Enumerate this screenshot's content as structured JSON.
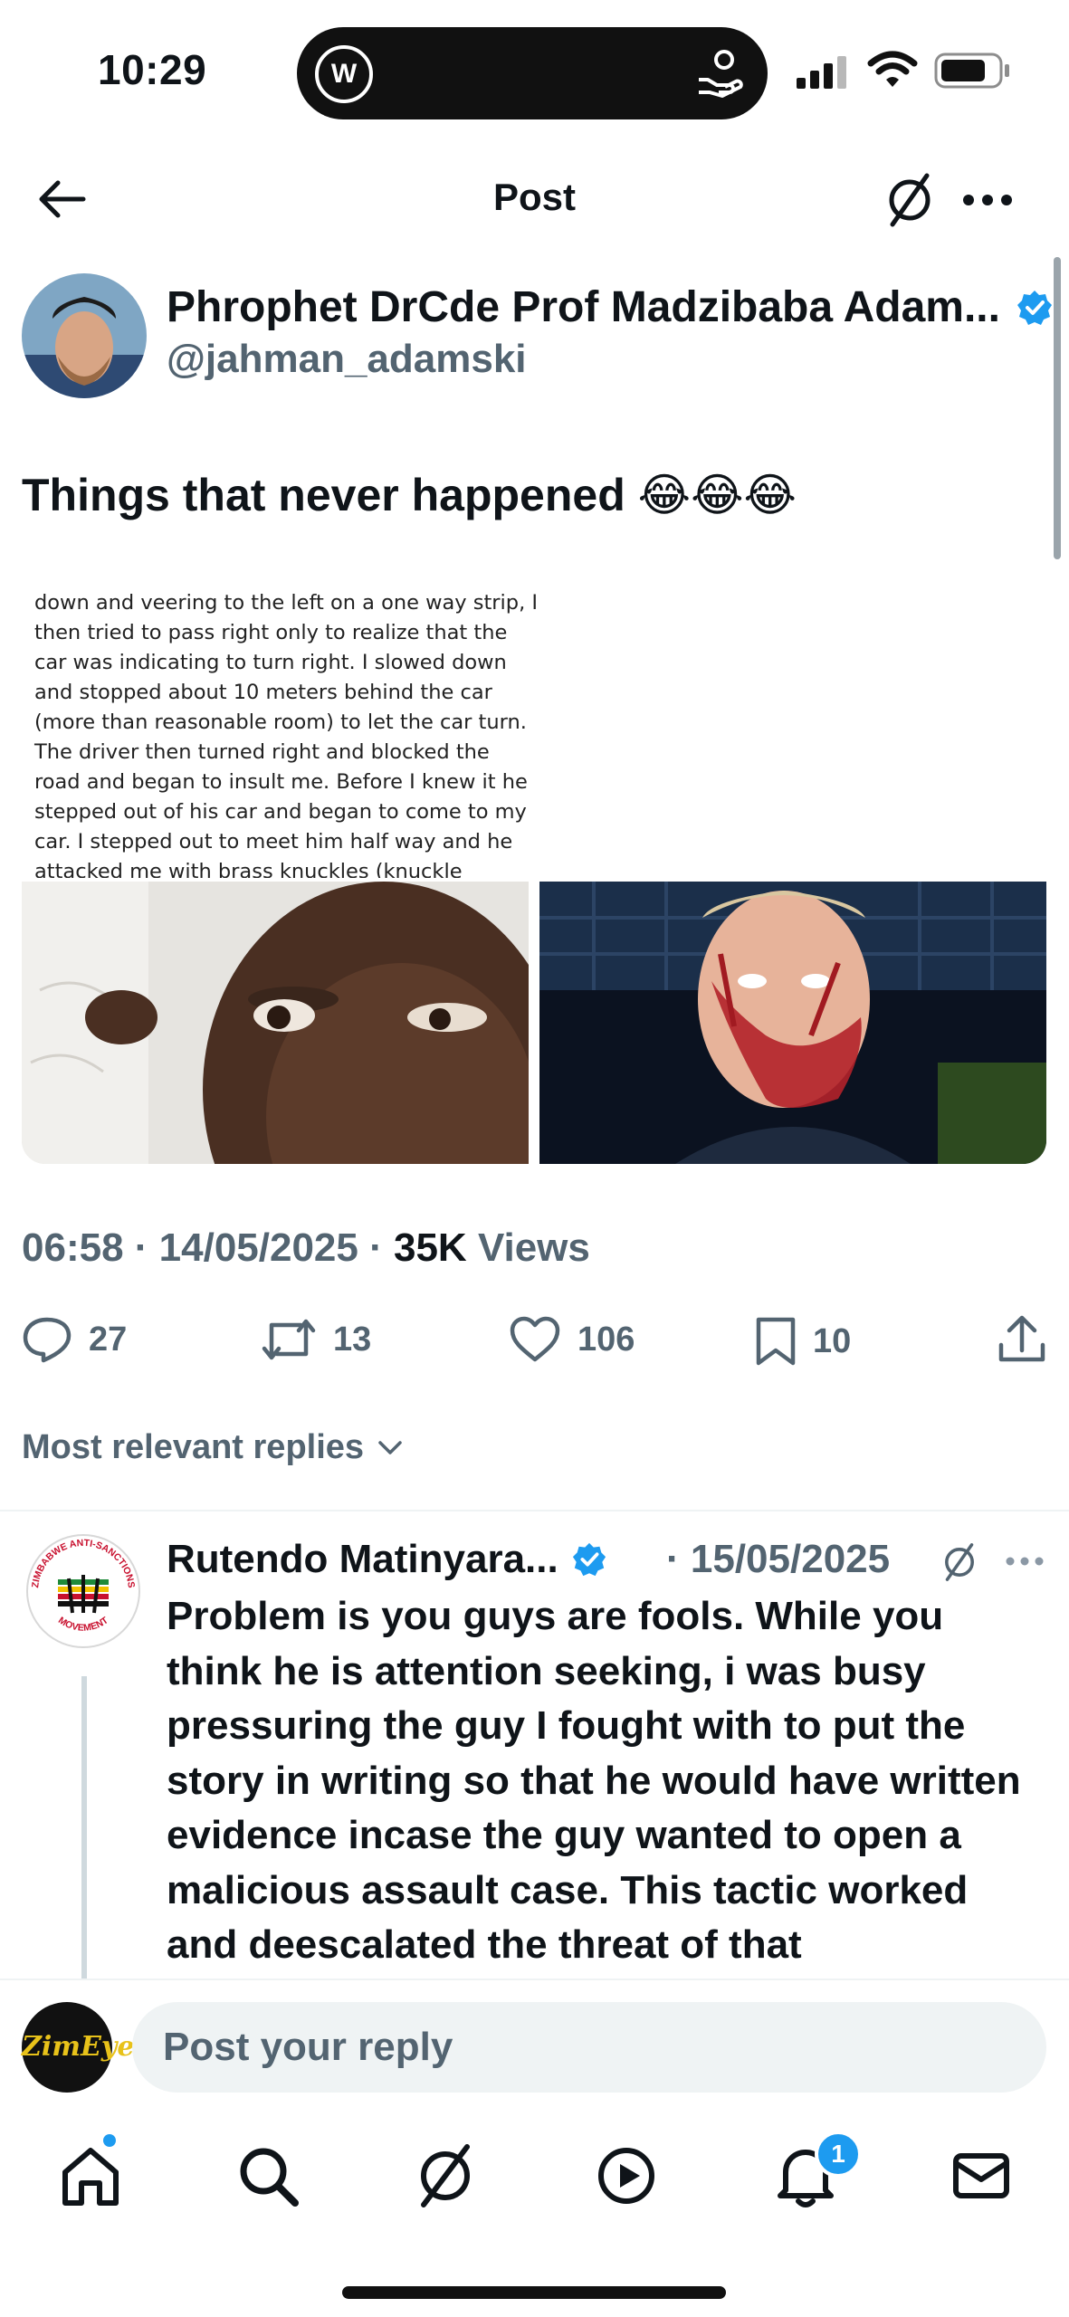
{
  "status": {
    "time": "10:29"
  },
  "header": {
    "title": "Post"
  },
  "post": {
    "author_name": "Phrophet DrCde Prof Madzibaba Adam...",
    "author_handle": "@jahman_adamski",
    "text": "Things that never happened 😂😂😂",
    "media_text": "down and veering to the left on a one way strip, I then tried to pass right only to realize that the car was indicating to turn right. I slowed down and stopped about 10 meters behind the car (more than reasonable room) to let the car turn. The driver then turned right and blocked the road and began to insult me. Before I knew it he stepped out of his car and began to come to my car. I stepped out to meet him half way and he attacked me with brass knuckles (knuckle",
    "time": "06:58",
    "date": "14/05/2025",
    "views_count": "35K",
    "views_label": "Views",
    "stats": {
      "replies": "27",
      "reposts": "13",
      "likes": "106",
      "bookmarks": "10"
    }
  },
  "replies_filter": "Most relevant replies",
  "reply": {
    "author_name": "Rutendo Matinyara...",
    "date": "15/05/2025",
    "avatar_text_top": "ZIMBABWE ANTI-SANCTIONS",
    "avatar_text_bottom": "MOVEMENT",
    "text": "Problem is you guys are fools. While you think he is attention seeking, i was busy pressuring the guy I fought with to put the story in writing so that he would have written evidence incase the guy wanted to open a malicious assault case. This tactic worked and deescalated the threat of that"
  },
  "composer": {
    "avatar_text": "ZimEye",
    "placeholder": "Post your reply"
  },
  "tabbar": {
    "notifications_badge": "1"
  },
  "colors": {
    "accent": "#1d9bf0",
    "text": "#0f1419",
    "muted": "#536471"
  }
}
